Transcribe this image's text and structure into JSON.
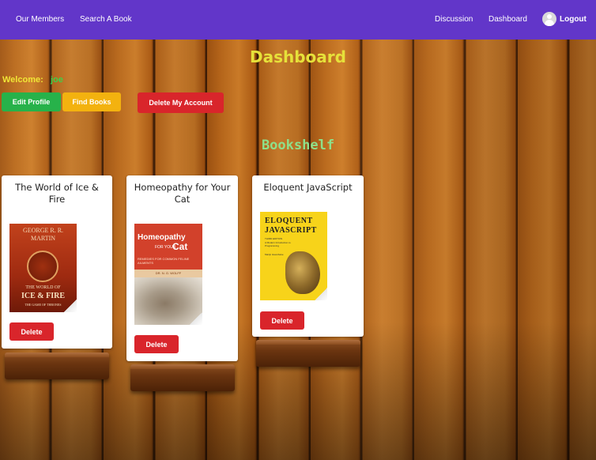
{
  "nav": {
    "members": "Our Members",
    "search": "Search A Book",
    "discussion": "Discussion",
    "dashboard": "Dashboard",
    "logout": "Logout"
  },
  "page": {
    "title": "Dashboard",
    "welcome_label": "Welcome:",
    "username": "joe",
    "edit_profile": "Edit Profile",
    "find_books": "Find Books",
    "delete_account": "Delete My Account",
    "bookshelf_title": "Bookshelf"
  },
  "books": [
    {
      "title": "The World of Ice & Fire",
      "delete": "Delete",
      "cover": {
        "author": "GEORGE R. R. MARTIN",
        "line1": "THE WORLD OF",
        "line2": "ICE & FIRE",
        "line3": "THE GAME OF THRONES"
      }
    },
    {
      "title": "Homeopathy for Your Cat",
      "delete": "Delete",
      "cover": {
        "line1": "Homeopathy",
        "line2": "FOR YOUR",
        "line3": "Cat",
        "subtitle": "REMEDIES FOR COMMON FELINE AILMENTS",
        "author": "DR. N. G. WOLFF"
      }
    },
    {
      "title": "Eloquent JavaScript",
      "delete": "Delete",
      "cover": {
        "line1": "ELOQUENT",
        "line2": "JAVASCRIPT",
        "edition": "THIRD EDITION",
        "subtitle": "A Modern Introduction to Programming",
        "author": "Marijn Haverbeke"
      }
    }
  ],
  "colors": {
    "navbar": "#6236c9",
    "title": "#e6e13a",
    "welcome": "#f0e636",
    "username": "#3cd34a",
    "bookshelf": "#8ee08a",
    "green_button": "#27b24a",
    "yellow_button": "#f3b20f",
    "red_button": "#d9252b"
  }
}
